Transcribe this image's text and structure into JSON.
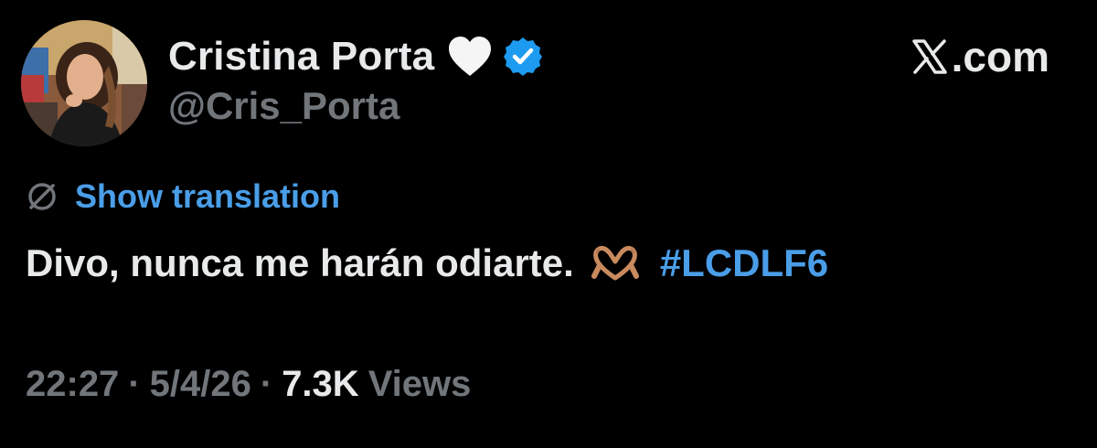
{
  "author": {
    "display_name": "Cristina Porta",
    "handle": "@Cris_Porta",
    "avatar_icon": "profile-photo",
    "badge_emoji_icon": "white-heart-icon",
    "verified_icon": "verified-badge-icon"
  },
  "brand": {
    "text": "X.com",
    "x_char": "𝕏",
    "label": ".com"
  },
  "translation": {
    "icon": "globe-icon",
    "label": "Show translation"
  },
  "tweet": {
    "text": "Divo, nunca me harán odiarte.",
    "emoji_icon": "heart-hands-icon",
    "hashtag": "#LCDLF6"
  },
  "meta": {
    "time": "22:27",
    "separator": "·",
    "date": "5/4/26",
    "views_count": "7.3K",
    "views_label": "Views"
  },
  "colors": {
    "background": "#000000",
    "primary_text": "#e7e9ea",
    "secondary_text": "#71767b",
    "accent": "#4a9ee8",
    "verified": "#1d9bf0"
  }
}
